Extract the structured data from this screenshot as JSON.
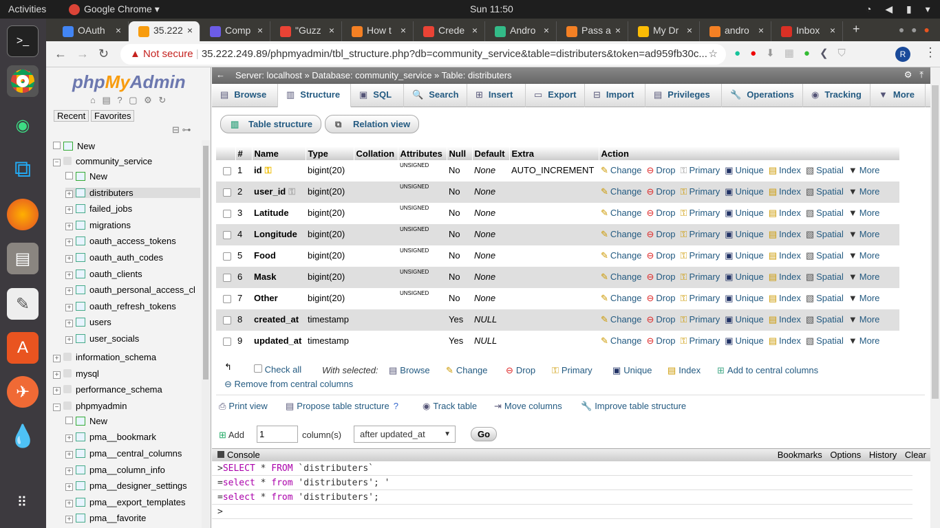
{
  "system": {
    "activities": "Activities",
    "app": "Google Chrome ▾",
    "clock": "Sun 11:50"
  },
  "tabs": [
    {
      "label": "OAuth",
      "color": "#4285f4"
    },
    {
      "label": "35.222",
      "color": "#f89c0e"
    },
    {
      "label": "Comp",
      "color": "#6c5ce7"
    },
    {
      "label": "\"Guzz",
      "color": "#ea4335"
    },
    {
      "label": "How t",
      "color": "#f48024"
    },
    {
      "label": "Crede",
      "color": "#ea4335"
    },
    {
      "label": "Andro",
      "color": "#3b8"
    },
    {
      "label": "Pass a",
      "color": "#f48024"
    },
    {
      "label": "My Dr",
      "color": "#fbbc05"
    },
    {
      "label": "andro",
      "color": "#f48024"
    },
    {
      "label": "Inbox",
      "color": "#d93025"
    }
  ],
  "browser": {
    "not_secure": "Not secure",
    "url": "35.222.249.89/phpmyadmin/tbl_structure.php?db=community_service&table=distributers&token=ad959fb30c...",
    "profile": "R"
  },
  "nav": {
    "recent": "Recent",
    "favorites": "Favorites",
    "items": [
      {
        "label": "New",
        "level": 0,
        "kind": "new"
      },
      {
        "label": "community_service",
        "level": 0,
        "kind": "db"
      },
      {
        "label": "New",
        "level": 1,
        "kind": "new"
      },
      {
        "label": "distributers",
        "level": 1,
        "kind": "tbl",
        "selected": true
      },
      {
        "label": "failed_jobs",
        "level": 1,
        "kind": "tbl"
      },
      {
        "label": "migrations",
        "level": 1,
        "kind": "tbl"
      },
      {
        "label": "oauth_access_tokens",
        "level": 1,
        "kind": "tbl"
      },
      {
        "label": "oauth_auth_codes",
        "level": 1,
        "kind": "tbl"
      },
      {
        "label": "oauth_clients",
        "level": 1,
        "kind": "tbl"
      },
      {
        "label": "oauth_personal_access_cl",
        "level": 1,
        "kind": "tbl"
      },
      {
        "label": "oauth_refresh_tokens",
        "level": 1,
        "kind": "tbl"
      },
      {
        "label": "users",
        "level": 1,
        "kind": "tbl"
      },
      {
        "label": "user_socials",
        "level": 1,
        "kind": "tbl"
      },
      {
        "label": "information_schema",
        "level": 0,
        "kind": "db"
      },
      {
        "label": "mysql",
        "level": 0,
        "kind": "db"
      },
      {
        "label": "performance_schema",
        "level": 0,
        "kind": "db"
      },
      {
        "label": "phpmyadmin",
        "level": 0,
        "kind": "db"
      },
      {
        "label": "New",
        "level": 1,
        "kind": "new"
      },
      {
        "label": "pma__bookmark",
        "level": 1,
        "kind": "tbl"
      },
      {
        "label": "pma__central_columns",
        "level": 1,
        "kind": "tbl"
      },
      {
        "label": "pma__column_info",
        "level": 1,
        "kind": "tbl"
      },
      {
        "label": "pma__designer_settings",
        "level": 1,
        "kind": "tbl"
      },
      {
        "label": "pma__export_templates",
        "level": 1,
        "kind": "tbl"
      },
      {
        "label": "pma__favorite",
        "level": 1,
        "kind": "tbl"
      }
    ]
  },
  "breadcrumb": {
    "server": "Server: localhost",
    "database": "Database: community_service",
    "table": "Table: distributers"
  },
  "main_tabs": [
    "Browse",
    "Structure",
    "SQL",
    "Search",
    "Insert",
    "Export",
    "Import",
    "Privileges",
    "Operations",
    "Tracking",
    "More"
  ],
  "sub_buttons": [
    "Table structure",
    "Relation view"
  ],
  "columns": [
    "#",
    "Name",
    "Type",
    "Collation",
    "Attributes",
    "Null",
    "Default",
    "Extra",
    "Action"
  ],
  "rows": [
    {
      "n": "1",
      "name": "id",
      "type": "bigint(20)",
      "attr": "UNSIGNED",
      "null": "No",
      "default": "None",
      "extra": "AUTO_INCREMENT"
    },
    {
      "n": "2",
      "name": "user_id",
      "type": "bigint(20)",
      "attr": "UNSIGNED",
      "null": "No",
      "default": "None",
      "extra": ""
    },
    {
      "n": "3",
      "name": "Latitude",
      "type": "bigint(20)",
      "attr": "UNSIGNED",
      "null": "No",
      "default": "None",
      "extra": ""
    },
    {
      "n": "4",
      "name": "Longitude",
      "type": "bigint(20)",
      "attr": "UNSIGNED",
      "null": "No",
      "default": "None",
      "extra": ""
    },
    {
      "n": "5",
      "name": "Food",
      "type": "bigint(20)",
      "attr": "UNSIGNED",
      "null": "No",
      "default": "None",
      "extra": ""
    },
    {
      "n": "6",
      "name": "Mask",
      "type": "bigint(20)",
      "attr": "UNSIGNED",
      "null": "No",
      "default": "None",
      "extra": ""
    },
    {
      "n": "7",
      "name": "Other",
      "type": "bigint(20)",
      "attr": "UNSIGNED",
      "null": "No",
      "default": "None",
      "extra": ""
    },
    {
      "n": "8",
      "name": "created_at",
      "type": "timestamp",
      "attr": "",
      "null": "Yes",
      "default": "NULL",
      "extra": ""
    },
    {
      "n": "9",
      "name": "updated_at",
      "type": "timestamp",
      "attr": "",
      "null": "Yes",
      "default": "NULL",
      "extra": ""
    }
  ],
  "row_actions": [
    "Change",
    "Drop",
    "Primary",
    "Unique",
    "Index",
    "Spatial",
    "More"
  ],
  "bulk": {
    "check_all": "Check all",
    "with_selected": "With selected:",
    "actions": [
      "Browse",
      "Change",
      "Drop",
      "Primary",
      "Unique",
      "Index",
      "Add to central columns"
    ],
    "remove_central": "Remove from central columns"
  },
  "links": [
    "Print view",
    "Propose table structure",
    "Track table",
    "Move columns",
    "Improve table structure"
  ],
  "add": {
    "label": "Add",
    "value": "1",
    "unit": "column(s)",
    "position": "after updated_at",
    "go": "Go"
  },
  "console": {
    "title": "Console",
    "bookmarks": "Bookmarks",
    "options": "Options",
    "history": "History",
    "clear": "Clear",
    "lines": [
      ">SELECT * FROM `distributers`",
      "=select * from 'distributers'; '",
      "=select * from 'distributers';",
      ">"
    ]
  }
}
